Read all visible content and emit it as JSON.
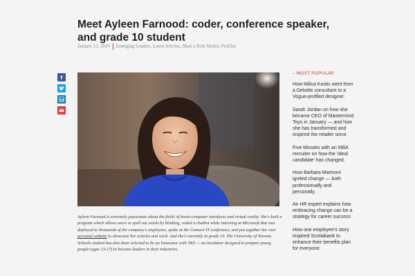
{
  "article": {
    "title": "Meet Ayleen Farnood: coder, conference speaker, and grade 10 student",
    "date": "January 13, 2019",
    "categories": "Emerging Leaders, Latest Articles, Meet a Role Model, Profiles",
    "caption": {
      "before": "Ayleen Farnood is extremely passionate about the fields of brain-computer interfaces and virtual reality. She's built a program which allows users to spell out words by blinking, coded a chatbot while interning at Microsoft that was deployed to thousands of the company's employees, spoke at the Connect IT conference, and put together her own ",
      "link": "personal website",
      "after": " to showcase her articles and work. And she's currently in grade 10. The University of Toronto Schools student has also been selected to be an Innovator with TKS — an incubator designed to prepare young people (ages 13-17) to become leaders in their industries."
    }
  },
  "share": {
    "icons": [
      "facebook-icon",
      "twitter-icon",
      "linkedin-icon",
      "email-icon"
    ],
    "colors": {
      "facebook": "#3b5998",
      "twitter": "#1da1f2",
      "linkedin": "#0077b5",
      "email": "#d9413a"
    }
  },
  "sidebar": {
    "heading": "– MOST POPULAR",
    "items": [
      "How Milica Kostic went from a Deloitte consultant to a Vogue-profiled designer.",
      "Sarah Jordan on how she became CEO of Mastermind Toys in January — and how she has transformed and inspired the retailer since.",
      "Five Minutes with an MBA recruiter on how the 'ideal candidate' has changed.",
      "How Barbara Marinoni ignited change — both professionally and personally.",
      "An HR expert explains how embracing change can be a strategy for career success",
      "How one employee's story inspired Scotiabank to enhance their benefits plan for everyone."
    ]
  },
  "colors": {
    "accent": "#c0392b",
    "text": "#1e1e1e",
    "muted": "#8a8a8a"
  }
}
